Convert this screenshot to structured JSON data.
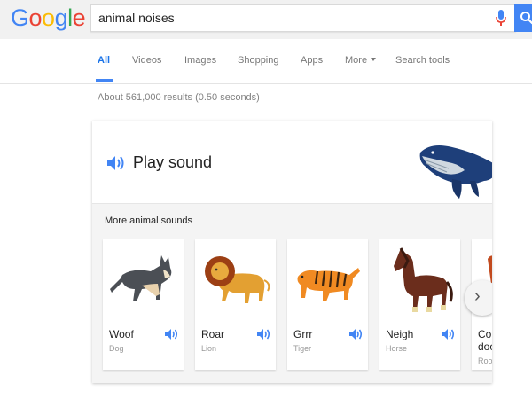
{
  "logo": {
    "letters": [
      "G",
      "o",
      "o",
      "g",
      "l",
      "e"
    ],
    "colors": [
      "#4285f4",
      "#ea4335",
      "#fbbc05",
      "#4285f4",
      "#34a853",
      "#ea4335"
    ]
  },
  "search": {
    "query": "animal noises"
  },
  "tabs": [
    {
      "label": "All"
    },
    {
      "label": "Videos"
    },
    {
      "label": "Images"
    },
    {
      "label": "Shopping"
    },
    {
      "label": "Apps"
    },
    {
      "label": "More"
    },
    {
      "label": "Search tools"
    }
  ],
  "results_stats": "About 561,000 results (0.50 seconds)",
  "card": {
    "play_label": "Play sound",
    "more_title": "More animal sounds",
    "animals": [
      {
        "sound": "Woof",
        "name": "Dog"
      },
      {
        "sound": "Roar",
        "name": "Lion"
      },
      {
        "sound": "Grrr",
        "name": "Tiger"
      },
      {
        "sound": "Neigh",
        "name": "Horse"
      },
      {
        "sound": "Co",
        "sound2": "doo",
        "name": "Roo"
      }
    ]
  },
  "colors": {
    "accent": "#4285f4"
  }
}
